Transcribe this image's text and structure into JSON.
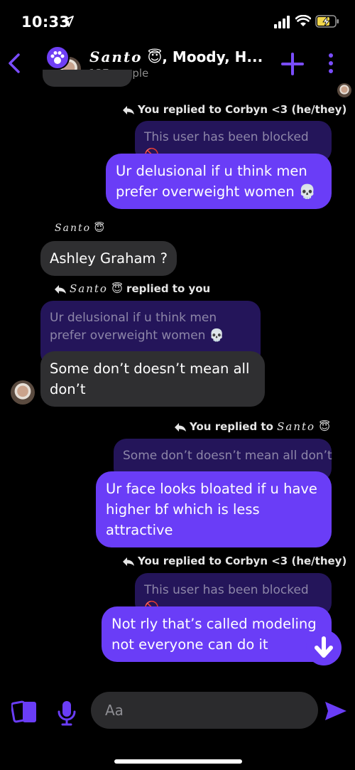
{
  "status": {
    "time": "10:33"
  },
  "header": {
    "title_script": "Santo",
    "title_emoji": "😇",
    "title_rest": ", Moody, H...",
    "subtitle": "137 people"
  },
  "messages": {
    "reply1_meta": "You replied to Corbyn <3 (he/they)",
    "reply1_quote": "This user has been blocked 🚫",
    "reply1_text": "Ur delusional if u think men prefer overweight women 💀",
    "santo_name": "Santo",
    "santo_emoji": "😇",
    "santo_msg1": "Ashley Graham ?",
    "santo_reply_meta_name": "Santo",
    "santo_reply_meta_emoji": "😇",
    "santo_reply_meta_rest": " replied to you",
    "santo_reply_quote": "Ur delusional if u think men prefer overweight women 💀",
    "santo_msg2": "Some don’t doesn’t mean all don’t",
    "reply2_meta_prefix": "You replied to ",
    "reply2_meta_name": "Santo",
    "reply2_meta_emoji": "😇",
    "reply2_quote": "Some don’t doesn’t mean all don’t",
    "reply2_text": "Ur face looks bloated if u have higher bf which is less attractive",
    "reply3_meta": "You replied to Corbyn <3 (he/they)",
    "reply3_quote": "This user has been blocked 🚫",
    "reply3_text": "Not rly that’s called modeling not everyone can do it"
  },
  "composer": {
    "placeholder": "Aa"
  },
  "colors": {
    "accent": "#6a3df7",
    "bubble_them": "#2f2f31",
    "quoted": "#24155a"
  }
}
